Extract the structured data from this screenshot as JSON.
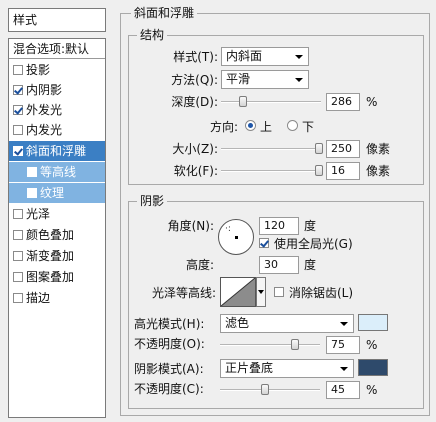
{
  "sidebar": {
    "title": "样式",
    "blend_label": "混合选项:默认",
    "items": [
      {
        "label": "投影",
        "checked": false
      },
      {
        "label": "内阴影",
        "checked": true
      },
      {
        "label": "外发光",
        "checked": true
      },
      {
        "label": "内发光",
        "checked": false
      },
      {
        "label": "斜面和浮雕",
        "checked": true,
        "selected": true
      },
      {
        "label": "等高线",
        "checked": false,
        "sub": true
      },
      {
        "label": "纹理",
        "checked": false,
        "sub": true
      },
      {
        "label": "光泽",
        "checked": false
      },
      {
        "label": "颜色叠加",
        "checked": false
      },
      {
        "label": "渐变叠加",
        "checked": false
      },
      {
        "label": "图案叠加",
        "checked": false
      },
      {
        "label": "描边",
        "checked": false
      }
    ]
  },
  "bevel": {
    "title": "斜面和浮雕",
    "structure": {
      "title": "结构",
      "style_label": "样式(T):",
      "style_value": "内斜面",
      "technique_label": "方法(Q):",
      "technique_value": "平滑",
      "depth_label": "深度(D):",
      "depth_value": "286",
      "depth_unit": "%",
      "depth_pos": 0.22,
      "direction_label": "方向:",
      "direction_up": "上",
      "direction_down": "下",
      "size_label": "大小(Z):",
      "size_value": "250",
      "size_unit": "像素",
      "size_pos": 0.98,
      "soften_label": "软化(F):",
      "soften_value": "16",
      "soften_unit": "像素",
      "soften_pos": 0.98
    },
    "shading": {
      "title": "阴影",
      "angle_label": "角度(N):",
      "angle_value": "120",
      "angle_unit": "度",
      "global_light_label": "使用全局光(G)",
      "global_light": true,
      "altitude_label": "高度:",
      "altitude_value": "30",
      "altitude_unit": "度",
      "gloss_label": "光泽等高线:",
      "antialias_label": "消除锯齿(L)",
      "antialias": false,
      "highlight_label": "高光模式(H):",
      "highlight_mode": "滤色",
      "highlight_color": "#dbeefa",
      "hl_opacity_label": "不透明度(O):",
      "hl_opacity_value": "75",
      "hl_opacity_unit": "%",
      "hl_opacity_pos": 0.75,
      "shadow_label": "阴影模式(A):",
      "shadow_mode": "正片叠底",
      "shadow_color": "#2e4a6b",
      "sh_opacity_label": "不透明度(C):",
      "sh_opacity_value": "45",
      "sh_opacity_unit": "%",
      "sh_opacity_pos": 0.45
    }
  }
}
